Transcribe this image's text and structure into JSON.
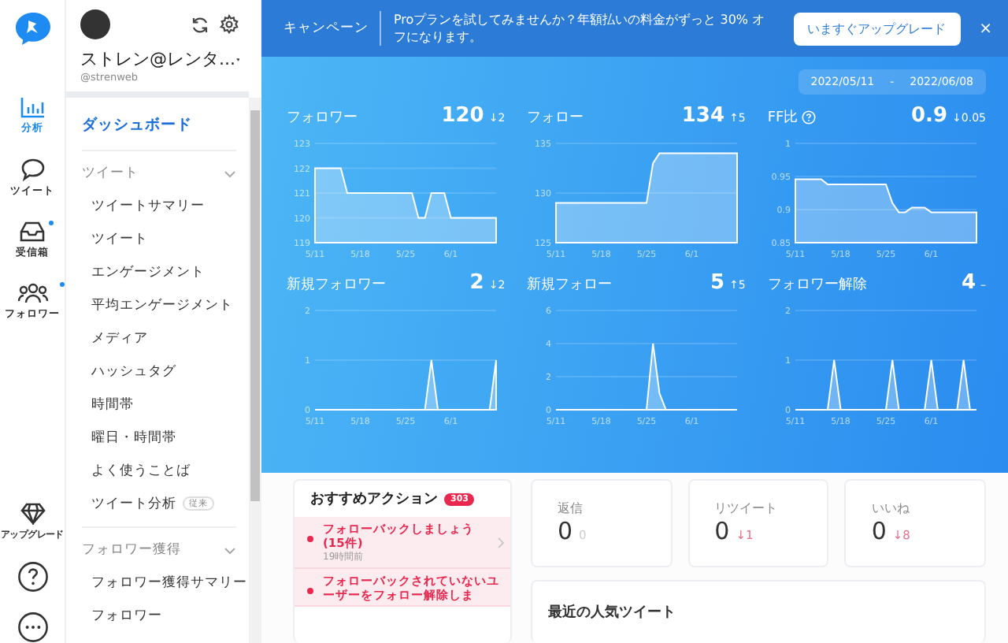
{
  "rail": {
    "items": [
      {
        "kind": "chart",
        "label": "分析",
        "selected": true,
        "badge": false
      },
      {
        "kind": "bubble",
        "label": "ツイート",
        "selected": false,
        "badge": false
      },
      {
        "kind": "inbox",
        "label": "受信箱",
        "selected": false,
        "badge": true
      },
      {
        "kind": "people",
        "label": "フォロワー",
        "selected": false,
        "badge": true
      }
    ],
    "upgrade": {
      "label": "アップグレード"
    }
  },
  "account": {
    "name": "ストレン@レンタ...",
    "handle": "@strenweb"
  },
  "sidebar": {
    "items": [
      {
        "kind": "link",
        "label": "ダッシュボード",
        "selected": true
      },
      {
        "kind": "section",
        "label": "ツイート",
        "expanded": true,
        "children": [
          {
            "label": "ツイートサマリー",
            "selected": false
          },
          {
            "label": "ツイート",
            "selected": false
          },
          {
            "label": "エンゲージメント",
            "selected": false
          },
          {
            "label": "平均エンゲージメント",
            "selected": false
          },
          {
            "label": "メディア",
            "selected": false
          },
          {
            "label": "ハッシュタグ",
            "selected": false
          },
          {
            "label": "時間帯",
            "selected": false
          },
          {
            "label": "曜日・時間帯",
            "selected": false
          },
          {
            "label": "よく使うことば",
            "selected": false
          },
          {
            "label": "ツイート分析",
            "tag": "従来",
            "selected": false
          }
        ]
      },
      {
        "kind": "section",
        "label": "フォロワー獲得",
        "expanded": true,
        "children": [
          {
            "label": "フォロワー獲得サマリー",
            "selected": false
          },
          {
            "label": "フォロワー",
            "selected": false
          }
        ]
      }
    ]
  },
  "banner": {
    "label": "キャンペーン",
    "message": "Proプランを試してみませんか？年額払いの料金がずっと 30% オフになります。",
    "button": "いますぐアップグレード",
    "close": "×"
  },
  "date_range": {
    "start": "2022/05/11",
    "separator": "-",
    "end": "2022/06/08"
  },
  "charts": [
    {
      "title": "フォロワー",
      "value": "120",
      "change": "↓2",
      "info_icon": false,
      "chart_data": {
        "type": "area",
        "grid": true,
        "categories": [
          "5/11",
          null,
          null,
          null,
          null,
          null,
          null,
          "5/18",
          null,
          null,
          null,
          null,
          null,
          null,
          "5/25",
          null,
          null,
          null,
          null,
          null,
          null,
          "6/1",
          null,
          null,
          null,
          null,
          null,
          null,
          null
        ],
        "ylim": [
          119,
          123
        ],
        "yticks": [
          119,
          120,
          121,
          122,
          123
        ],
        "series": [
          {
            "color": "#ffffff",
            "values": [
              122,
              122,
              122,
              122,
              122,
              121,
              121,
              121,
              121,
              121,
              121,
              121,
              121,
              121,
              121,
              121,
              120,
              120,
              121,
              121,
              121,
              120,
              120,
              120,
              120,
              120,
              120,
              120,
              120
            ]
          }
        ]
      }
    },
    {
      "title": "フォロー",
      "value": "134",
      "change": "↑5",
      "info_icon": false,
      "chart_data": {
        "type": "area",
        "grid": true,
        "categories": [
          "5/11",
          null,
          null,
          null,
          null,
          null,
          null,
          "5/18",
          null,
          null,
          null,
          null,
          null,
          null,
          "5/25",
          null,
          null,
          null,
          null,
          null,
          null,
          "6/1",
          null,
          null,
          null,
          null,
          null,
          null,
          null
        ],
        "ylim": [
          125,
          135
        ],
        "yticks": [
          125,
          130,
          135
        ],
        "series": [
          {
            "color": "#ffffff",
            "values": [
              129,
              129,
              129,
              129,
              129,
              129,
              129,
              129,
              129,
              129,
              129,
              129,
              129,
              129,
              129,
              133,
              134,
              134,
              134,
              134,
              134,
              134,
              134,
              134,
              134,
              134,
              134,
              134,
              134
            ]
          }
        ]
      }
    },
    {
      "title": "FF比",
      "value": "0.9",
      "change": "↓0.05",
      "info_icon": true,
      "chart_data": {
        "type": "area",
        "grid": true,
        "categories": [
          "5/11",
          null,
          null,
          null,
          null,
          null,
          null,
          "5/18",
          null,
          null,
          null,
          null,
          null,
          null,
          "5/25",
          null,
          null,
          null,
          null,
          null,
          null,
          "6/1",
          null,
          null,
          null,
          null,
          null,
          null,
          null
        ],
        "ylim": [
          0.85,
          1
        ],
        "yticks": [
          0.85,
          0.9,
          0.95,
          1
        ],
        "series": [
          {
            "color": "#ffffff",
            "values": [
              0.946,
              0.946,
              0.946,
              0.946,
              0.946,
              0.938,
              0.938,
              0.938,
              0.938,
              0.938,
              0.938,
              0.938,
              0.938,
              0.938,
              0.938,
              0.91,
              0.896,
              0.896,
              0.903,
              0.903,
              0.903,
              0.896,
              0.896,
              0.896,
              0.896,
              0.896,
              0.896,
              0.896,
              0.896
            ]
          }
        ]
      }
    },
    {
      "title": "新規フォロワー",
      "value": "2",
      "change": "↓2",
      "info_icon": false,
      "chart_data": {
        "type": "area",
        "grid": true,
        "categories": [
          "5/11",
          null,
          null,
          null,
          null,
          null,
          null,
          "5/18",
          null,
          null,
          null,
          null,
          null,
          null,
          "5/25",
          null,
          null,
          null,
          null,
          null,
          null,
          "6/1",
          null,
          null,
          null,
          null,
          null,
          null,
          null
        ],
        "ylim": [
          0,
          2
        ],
        "yticks": [
          0,
          1,
          2
        ],
        "series": [
          {
            "color": "#ffffff",
            "values": [
              0,
              0,
              0,
              0,
              0,
              0,
              0,
              0,
              0,
              0,
              0,
              0,
              0,
              0,
              0,
              0,
              0,
              0,
              1,
              0,
              0,
              0,
              0,
              0,
              0,
              0,
              0,
              0,
              1
            ]
          }
        ]
      }
    },
    {
      "title": "新規フォロー",
      "value": "5",
      "change": "↑5",
      "info_icon": false,
      "chart_data": {
        "type": "area",
        "grid": true,
        "categories": [
          "5/11",
          null,
          null,
          null,
          null,
          null,
          null,
          "5/18",
          null,
          null,
          null,
          null,
          null,
          null,
          "5/25",
          null,
          null,
          null,
          null,
          null,
          null,
          "6/1",
          null,
          null,
          null,
          null,
          null,
          null,
          null
        ],
        "ylim": [
          0,
          6
        ],
        "yticks": [
          0,
          2,
          4,
          6
        ],
        "series": [
          {
            "color": "#ffffff",
            "values": [
              0,
              0,
              0,
              0,
              0,
              0,
              0,
              0,
              0,
              0,
              0,
              0,
              0,
              0,
              0,
              4,
              1,
              0,
              0,
              0,
              0,
              0,
              0,
              0,
              0,
              0,
              0,
              0,
              0
            ]
          }
        ]
      }
    },
    {
      "title": "フォロワー解除",
      "value": "4",
      "change": "–",
      "info_icon": false,
      "chart_data": {
        "type": "area",
        "grid": true,
        "categories": [
          "5/11",
          null,
          null,
          null,
          null,
          null,
          null,
          "5/18",
          null,
          null,
          null,
          null,
          null,
          null,
          "5/25",
          null,
          null,
          null,
          null,
          null,
          null,
          "6/1",
          null,
          null,
          null,
          null,
          null,
          null,
          null
        ],
        "ylim": [
          0,
          2
        ],
        "yticks": [
          0,
          1,
          2
        ],
        "series": [
          {
            "color": "#ffffff",
            "values": [
              0,
              0,
              0,
              0,
              0,
              0,
              1,
              0,
              0,
              0,
              0,
              0,
              0,
              0,
              0,
              1,
              0,
              0,
              0,
              0,
              0,
              1,
              0,
              0,
              0,
              0,
              1,
              0,
              0
            ]
          }
        ]
      }
    }
  ],
  "actions": {
    "title": "おすすめアクション",
    "count": "303",
    "items": [
      {
        "text": "フォローバックしましょう (15件)",
        "time": "19時間前"
      },
      {
        "text": "フォローバックされていないユーザーをフォロー解除しま"
      }
    ]
  },
  "stats": [
    {
      "label": "返信",
      "value": "0",
      "change": "0",
      "color": "#cccccc"
    },
    {
      "label": "リツイート",
      "value": "0",
      "change": "↓1",
      "color": "#e8708a"
    },
    {
      "label": "いいね",
      "value": "0",
      "change": "↓8",
      "color": "#e8708a"
    }
  ],
  "popular": {
    "title": "最近の人気ツイート"
  }
}
